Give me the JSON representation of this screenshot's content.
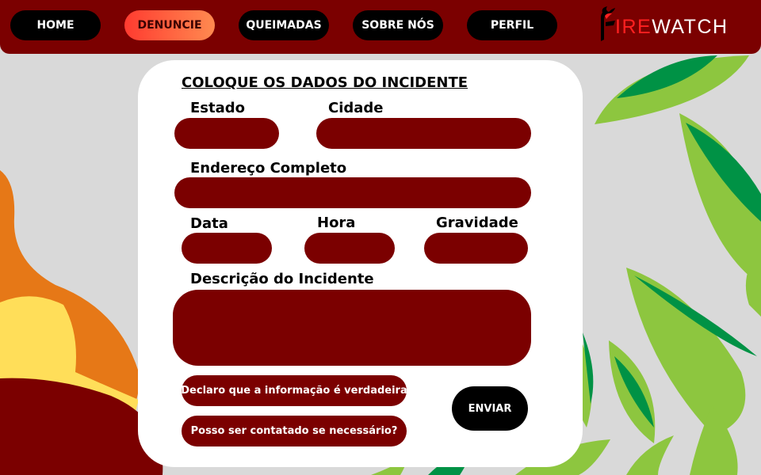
{
  "nav": {
    "items": [
      {
        "label": "HOME"
      },
      {
        "label": "DENUNCIE"
      },
      {
        "label": "QUEIMADAS"
      },
      {
        "label": "SOBRE NÓS"
      },
      {
        "label": "PERFIL"
      }
    ],
    "active": "DENUNCIE"
  },
  "logo": {
    "letter_f_icon": "flame-f-icon",
    "red_part": "IRE",
    "white_part": "WATCH"
  },
  "form": {
    "title": "COLOQUE OS DADOS DO INCIDENTE",
    "labels": {
      "estado": "Estado",
      "cidade": "Cidade",
      "endereco": "Endereço Completo",
      "data": "Data",
      "hora": "Hora",
      "gravidade": "Gravidade",
      "descricao": "Descrição do Incidente"
    },
    "checkboxes": {
      "declaro": "Declaro que a informação é verdadeira",
      "contato": "Posso ser contatado se necessário?"
    },
    "submit": "ENVIAR"
  },
  "colors": {
    "primary": "#7b0000",
    "background": "#d9d9d9",
    "leaf_dark": "#009245",
    "leaf_light": "#8dc63f",
    "flame_orange": "#e67817",
    "flame_yellow": "#ffde59",
    "active_gradient_start": "#ff3b30",
    "active_gradient_end": "#ff8a50"
  }
}
